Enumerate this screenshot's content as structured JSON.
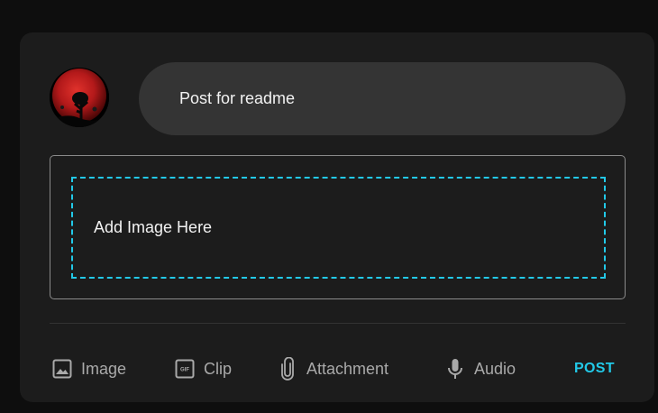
{
  "composer": {
    "input_text": "Post for readme",
    "drop_zone_label": "Add Image Here",
    "post_label": "POST",
    "accent_color": "#22c9e8"
  },
  "actions": [
    {
      "label": "Image",
      "icon": "image-icon"
    },
    {
      "label": "Clip",
      "icon": "gif-icon"
    },
    {
      "label": "Attachment",
      "icon": "paperclip-icon"
    },
    {
      "label": "Audio",
      "icon": "microphone-icon"
    }
  ]
}
